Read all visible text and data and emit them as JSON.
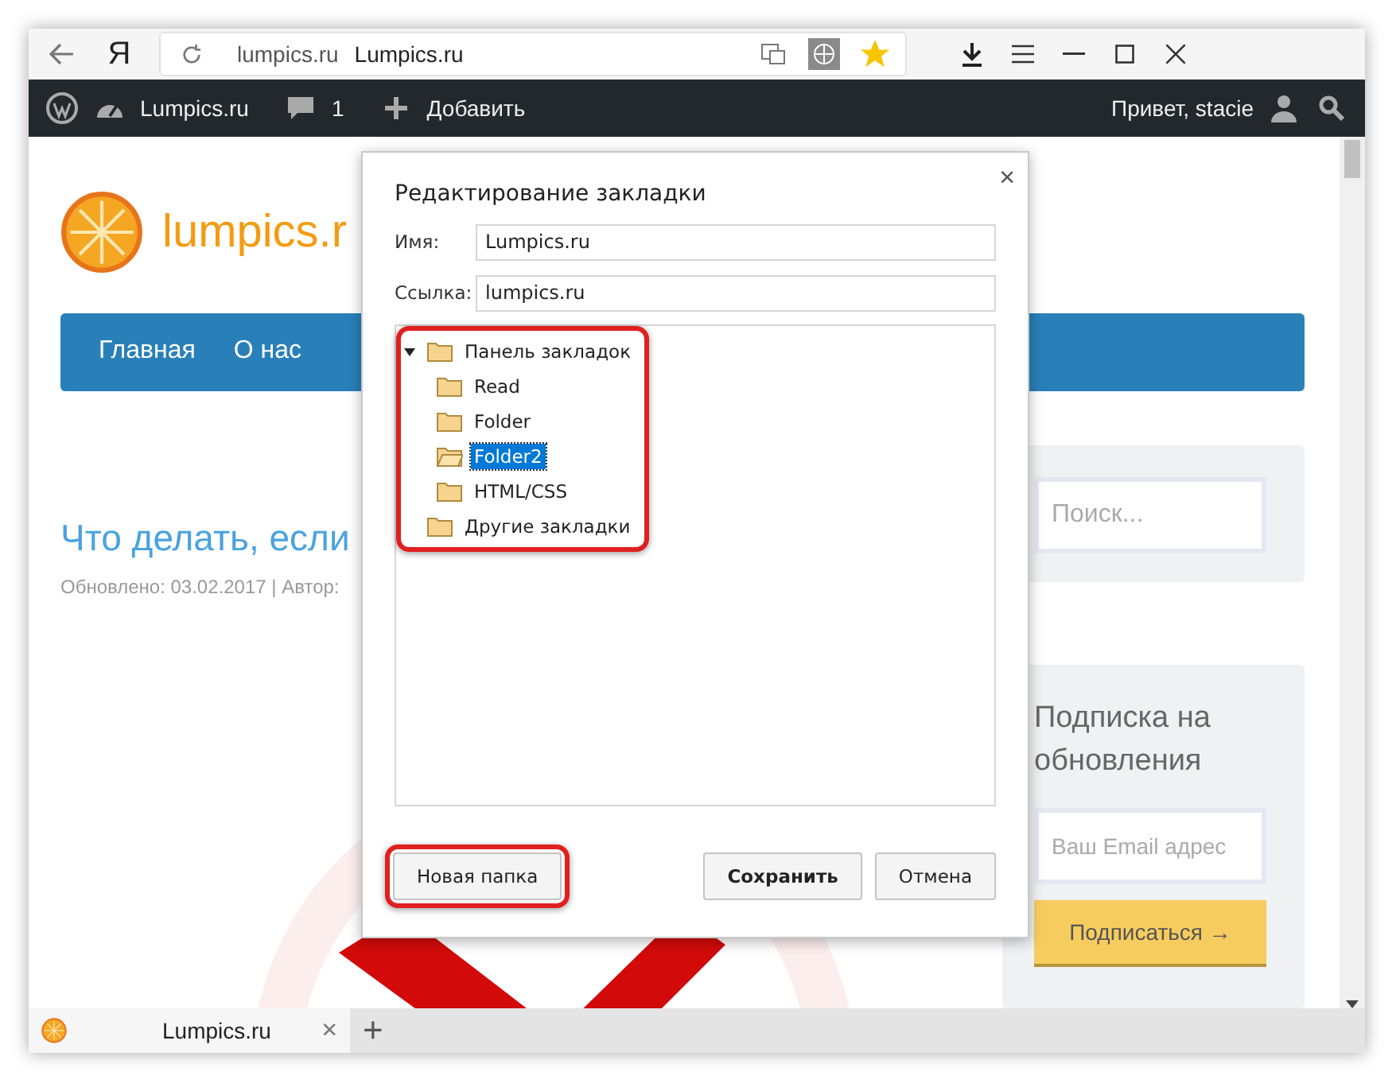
{
  "browser": {
    "logo": "Я",
    "address": {
      "domain": "lumpics.ru",
      "title": "Lumpics.ru",
      "bookmarked": true
    }
  },
  "admin_bar": {
    "site": "Lumpics.ru",
    "comments": "1",
    "add": "Добавить",
    "greeting": "Привет, stacie"
  },
  "site": {
    "logo_text": "lumpics.r",
    "nav": [
      "Главная",
      "О нас"
    ],
    "post_title": "Что делать, если",
    "post_meta": "Обновлено: 03.02.2017 | Автор:",
    "search_placeholder": "Поиск...",
    "subscribe_title": "Подписка на обновления",
    "email_placeholder": "Ваш Email адрес",
    "subscribe_button": "Подписаться →",
    "picture": {
      "kind": "picture"
    }
  },
  "dialog": {
    "title": "Редактирование закладки",
    "close": "×",
    "fields": [
      {
        "label": "Имя:",
        "value": "Lumpics.ru"
      },
      {
        "label": "Ссылка:",
        "value": "lumpics.ru"
      }
    ],
    "tree": [
      {
        "label": "Панель закладок",
        "expanded": true,
        "selected": false,
        "children": [
          {
            "label": "Read",
            "selected": false
          },
          {
            "label": "Folder",
            "selected": false
          },
          {
            "label": "Folder2",
            "selected": true
          },
          {
            "label": "HTML/CSS",
            "selected": false
          }
        ]
      },
      {
        "label": "Другие закладки",
        "selected": false
      }
    ],
    "buttons": [
      {
        "label": "Новая папка",
        "kind": "new-folder",
        "highlighted": true
      },
      {
        "label": "Сохранить",
        "kind": "default",
        "highlighted": false
      },
      {
        "label": "Отмена",
        "kind": "cancel",
        "highlighted": false
      }
    ],
    "tree_highlighted": true
  },
  "tabs": [
    {
      "label": "Lumpics.ru",
      "selected": true,
      "close": "×"
    }
  ],
  "new_tab": "+"
}
